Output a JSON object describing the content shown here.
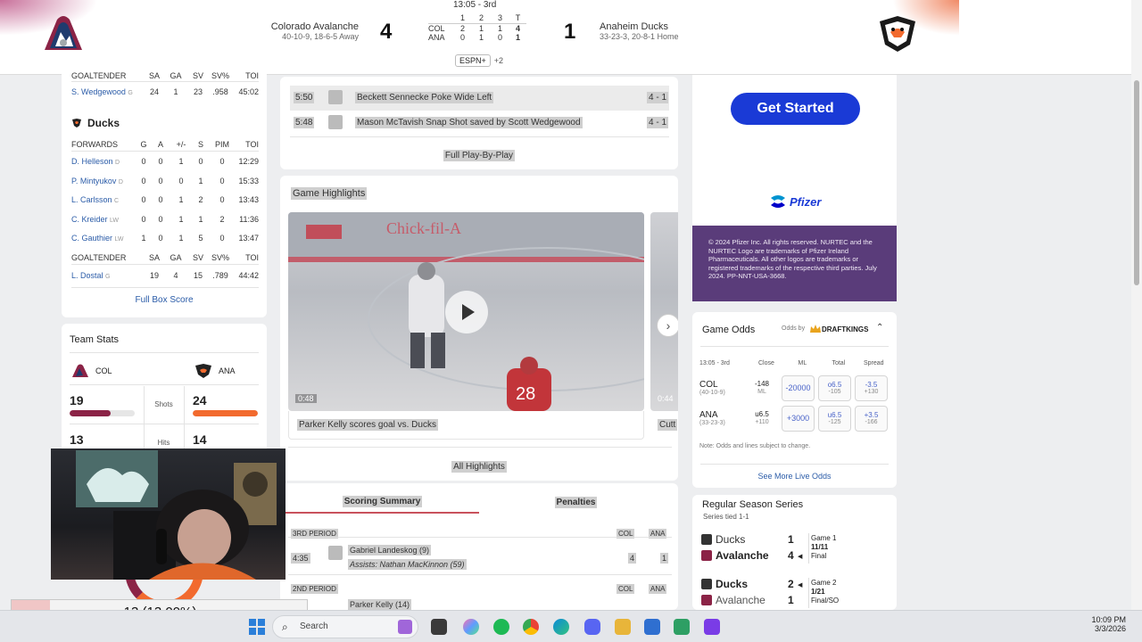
{
  "header": {
    "clock": "13:05 - 3rd",
    "home": {
      "name": "Colorado Avalanche",
      "record": "40-10-9, 18-6-5 Away",
      "score": "4"
    },
    "away": {
      "name": "Anaheim Ducks",
      "record": "33-23-3, 20-8-1 Home",
      "score": "1"
    },
    "linescore": {
      "headers": [
        "1",
        "2",
        "3",
        "T"
      ],
      "rows": [
        {
          "team": "COL",
          "p1": "2",
          "p2": "1",
          "p3": "1",
          "t": "4"
        },
        {
          "team": "ANA",
          "p1": "0",
          "p2": "1",
          "p3": "0",
          "t": "1"
        }
      ]
    },
    "network": "ESPN+",
    "network_more": "+2"
  },
  "boxscore": {
    "col_goalie_header": [
      "GOALTENDER",
      "SA",
      "GA",
      "SV",
      "SV%",
      "TOI"
    ],
    "col_goalie": {
      "name": "S. Wedgewood",
      "pos": "G",
      "sa": "24",
      "ga": "1",
      "sv": "23",
      "svp": ".958",
      "toi": "45:02"
    },
    "ducks_title": "Ducks",
    "forwards_header": [
      "FORWARDS",
      "G",
      "A",
      "+/-",
      "S",
      "PIM",
      "TOI"
    ],
    "forwards": [
      {
        "name": "D. Helleson",
        "pos": "D",
        "g": "0",
        "a": "0",
        "pm": "1",
        "s": "0",
        "pim": "0",
        "toi": "12:29"
      },
      {
        "name": "P. Mintyukov",
        "pos": "D",
        "g": "0",
        "a": "0",
        "pm": "0",
        "s": "1",
        "pim": "0",
        "toi": "15:33"
      },
      {
        "name": "L. Carlsson",
        "pos": "C",
        "g": "0",
        "a": "0",
        "pm": "1",
        "s": "2",
        "pim": "0",
        "toi": "13:43"
      },
      {
        "name": "C. Kreider",
        "pos": "LW",
        "g": "0",
        "a": "0",
        "pm": "1",
        "s": "1",
        "pim": "2",
        "toi": "11:36"
      },
      {
        "name": "C. Gauthier",
        "pos": "LW",
        "g": "1",
        "a": "0",
        "pm": "1",
        "s": "5",
        "pim": "0",
        "toi": "13:47"
      }
    ],
    "ana_goalie_header": [
      "GOALTENDER",
      "SA",
      "GA",
      "SV",
      "SV%",
      "TOI"
    ],
    "ana_goalie": {
      "name": "L. Dostal",
      "pos": "G",
      "sa": "19",
      "ga": "4",
      "sv": "15",
      "svp": ".789",
      "toi": "44:42"
    },
    "full_link": "Full Box Score"
  },
  "team_stats": {
    "title": "Team Stats",
    "home_abbr": "COL",
    "away_abbr": "ANA",
    "shots_label": "Shots",
    "home_shots": "19",
    "away_shots": "24",
    "home_shots_frac": 0.44,
    "away_shots_frac": 0.56,
    "hits_label": "Hits",
    "home_hits": "13",
    "away_hits": "14"
  },
  "pbp": {
    "rows": [
      {
        "time": "5:50",
        "text": "Beckett Sennecke Poke Wide Left",
        "score": "4 - 1"
      },
      {
        "time": "5:48",
        "text": "Mason McTavish Snap Shot saved by Scott Wedgewood",
        "score": "4 - 1"
      }
    ],
    "full_link": "Full Play-By-Play"
  },
  "highlights": {
    "title": "Game Highlights",
    "video1": {
      "duration": "0:48",
      "caption": "Parker Kelly scores goal vs. Ducks"
    },
    "video2": {
      "duration": "0:44",
      "caption": "Cutt"
    },
    "all_link": "All Highlights"
  },
  "scoring": {
    "tab1": "Scoring Summary",
    "tab2": "Penalties",
    "p3_label": "3RD PERIOD",
    "p2_label": "2ND PERIOD",
    "col": "COL",
    "ana": "ANA",
    "goal1": {
      "time": "4:35",
      "scorer": "Gabriel Landeskog (9)",
      "assists": "Assists: Nathan MacKinnon (59)",
      "col": "4",
      "ana": "1"
    },
    "goal2": {
      "scorer": "Parker Kelly (14)"
    }
  },
  "ad": {
    "cta": "Get Started",
    "brand": "Pfizer",
    "legal": "© 2024 Pfizer Inc. All rights reserved. NURTEC and the NURTEC Logo are trademarks of Pfizer Ireland Pharmaceuticals. All other logos are trademarks or registered trademarks of the respective third parties. July 2024. PP-NNT-USA-3668."
  },
  "odds": {
    "title": "Game Odds",
    "odds_by": "Odds by",
    "provider": "DRAFTKINGS",
    "headers": [
      "13:05 - 3rd",
      "Close",
      "ML",
      "Total",
      "Spread"
    ],
    "rows": [
      {
        "team": "COL",
        "rec": "(40-10-9)",
        "close1": "-148",
        "close2": "ML",
        "ml": "-20000",
        "total1": "o6.5",
        "total2": "-105",
        "spread1": "-3.5",
        "spread2": "+130"
      },
      {
        "team": "ANA",
        "rec": "(33-23-3)",
        "close1": "u6.5",
        "close2": "+110",
        "ml": "+3000",
        "total1": "u6.5",
        "total2": "-125",
        "spread1": "+3.5",
        "spread2": "-166"
      }
    ],
    "note": "Note: Odds and lines subject to change.",
    "more_link": "See More Live Odds"
  },
  "series": {
    "title": "Regular Season Series",
    "subtitle": "Series tied 1-1",
    "games": [
      {
        "t1": "Ducks",
        "s1": "1",
        "t2": "Avalanche",
        "s2": "4",
        "game": "Game 1",
        "date": "11/11",
        "status": "Final"
      },
      {
        "t1": "Ducks",
        "s1": "2",
        "t2": "Avalanche",
        "s2": "1",
        "game": "Game 2",
        "date": "1/21",
        "status": "Final/SO"
      }
    ]
  },
  "progress": {
    "label": "13 (13.00%)",
    "fraction": 0.13
  },
  "taskbar": {
    "search": "Search",
    "time": "10:09 PM",
    "date": "3/3/2026"
  },
  "colors": {
    "col_maroon": "#8b2346",
    "ana_orange": "#f26a2e",
    "espn_blue": "#1a3ad6"
  }
}
